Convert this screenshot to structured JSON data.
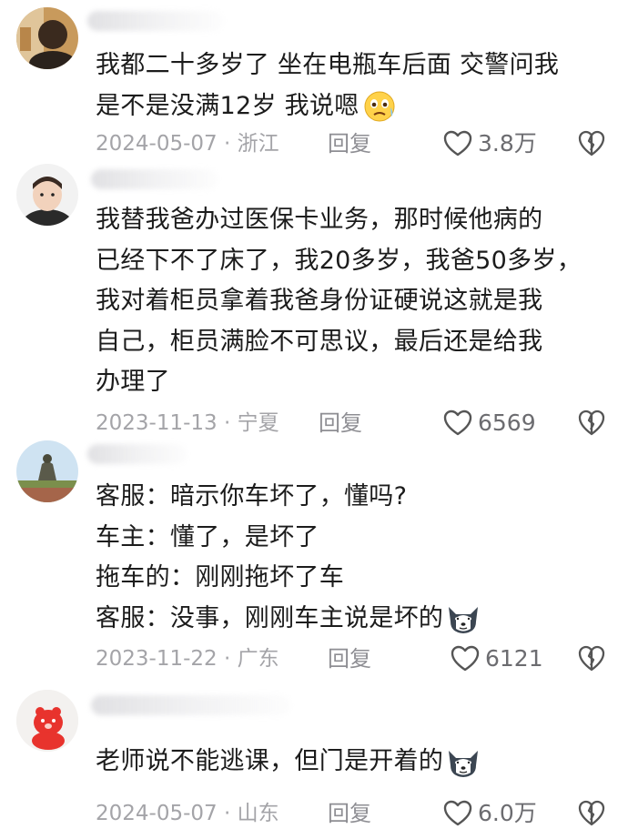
{
  "comments": [
    {
      "lines": [
        "我都二十多岁了 坐在电瓶车后面 交警问我",
        "是不是没满12岁 我说嗯"
      ],
      "emoji": "worried-face-emoji",
      "date": "2024-05-07",
      "location": "浙江",
      "reply_label": "回复",
      "likes": "3.8万"
    },
    {
      "lines": [
        "我替我爸办过医保卡业务，那时候他病的",
        "已经下不了床了，我20多岁，我爸50多岁，",
        "我对着柜员拿着我爸身份证硬说这就是我",
        "自己，柜员满脸不可思议，最后还是给我",
        "办理了"
      ],
      "emoji": "",
      "date": "2023-11-13",
      "location": "宁夏",
      "reply_label": "回复",
      "likes": "6569"
    },
    {
      "lines": [
        "客服：暗示你车坏了，懂吗?",
        "车主：懂了，是坏了",
        "拖车的：刚刚拖坏了车",
        "客服：没事，刚刚车主说是坏的"
      ],
      "emoji": "husky-emoji",
      "date": "2023-11-22",
      "location": "广东",
      "reply_label": "回复",
      "likes": "6121"
    },
    {
      "lines": [
        "老师说不能逃课，但门是开着的"
      ],
      "emoji": "husky-emoji",
      "date": "2024-05-07",
      "location": "山东",
      "reply_label": "回复",
      "likes": "6.0万"
    }
  ],
  "separator": "·",
  "colors": {
    "meta": "#a4a4a8",
    "text": "#1c1c1c",
    "icon": "#555555"
  }
}
